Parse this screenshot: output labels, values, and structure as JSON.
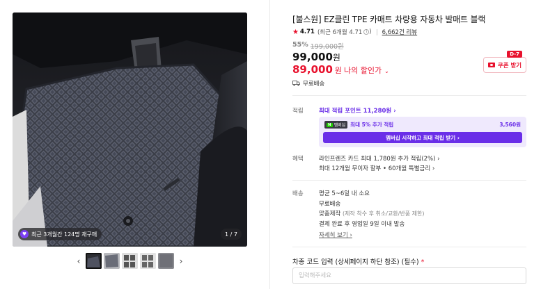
{
  "gallery": {
    "repurchase_badge": "최근 3개월간 124명 재구매",
    "counter": "1 / 7",
    "prev_arrow": "‹",
    "next_arrow": "›",
    "thumbnail_count": 5
  },
  "product": {
    "title": "[불스원] EZ클린 TPE 카매트 차량용 자동차 발매트 블랙",
    "rating": "4.71",
    "recent_rating": "(최근 6개월 4.71",
    "recent_rating_close": ")",
    "review_count": "6,662건 리뷰",
    "discount_rate": "55%",
    "original_price": "199,000원",
    "price": "99,000",
    "price_unit": "원",
    "my_price": "89,000",
    "my_price_unit": "원",
    "my_price_label": "나의 할인가",
    "coupon_tag": "D-7",
    "coupon_label": "쿠폰 받기",
    "shipping": "무료배송"
  },
  "points": {
    "label": "적립",
    "max_points": "최대 적립 포인트 11,280원 ›",
    "membership_badge": "멤버십",
    "membership_badge_n": "N",
    "membership_title": "최대 5% 추가 적립",
    "membership_amount": "3,560원",
    "membership_button": "멤버십 시작하고 최대 적립 받기 ›"
  },
  "benefits": {
    "label": "혜택",
    "line1": "라인프렌즈 카드 최대 1,780원 추가 적립(2%) ›",
    "line2": "최대 12개월 무이자 할부 • 60개월 특별금리 ›"
  },
  "delivery": {
    "label": "배송",
    "line1": "평균 5~6일 내 소요",
    "line2": "무료배송",
    "line3_main": "맞춤제작",
    "line3_note": "(제작 착수 후 취소/교환/반품 제한)",
    "line4": "결제 완료 후 영업일 9일 이내 발송",
    "more": "자세히 보기 ›"
  },
  "option_input": {
    "label": "차종 코드 입력 (상세페이지 하단 참조) (필수)",
    "required_mark": "*",
    "placeholder": "입력해주세요"
  },
  "colors": {
    "accent_red": "#e8112d",
    "accent_purple": "#6a2ee8",
    "membership_bg": "#efe9fd"
  }
}
